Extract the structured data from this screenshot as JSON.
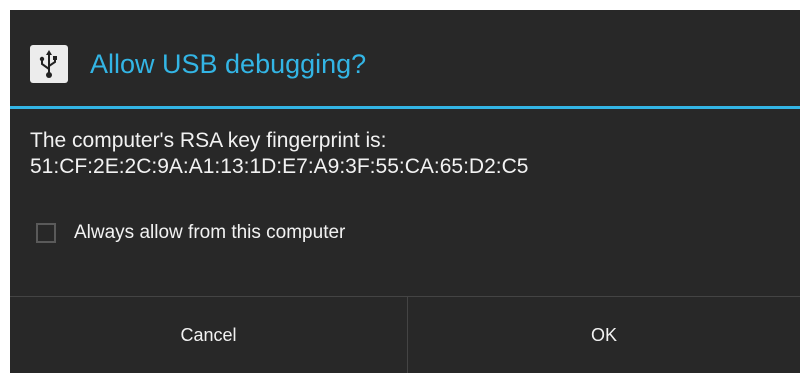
{
  "dialog": {
    "title": "Allow USB debugging?",
    "icon": "usb-icon",
    "message_line1": "The computer's RSA key fingerprint is:",
    "message_line2": "51:CF:2E:2C:9A:A1:13:1D:E7:A9:3F:55:CA:65:D2:C5",
    "checkbox": {
      "label": "Always allow from this computer",
      "checked": false
    },
    "buttons": {
      "cancel_label": "Cancel",
      "ok_label": "OK"
    }
  },
  "colors": {
    "accent": "#33b5e5",
    "background": "#282828",
    "text": "#f2f2f2",
    "divider": "#444444"
  }
}
